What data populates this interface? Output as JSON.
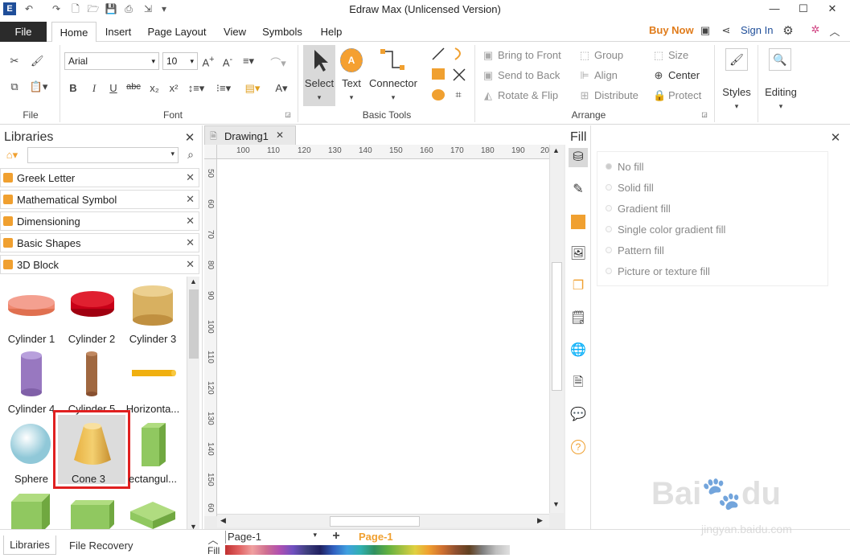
{
  "window": {
    "title": "Edraw Max (Unlicensed Version)"
  },
  "menu": {
    "file": "File",
    "tabs": [
      "Home",
      "Insert",
      "Page Layout",
      "View",
      "Symbols",
      "Help"
    ],
    "buy_now": "Buy Now",
    "sign_in": "Sign In"
  },
  "ribbon": {
    "font_family": "Arial",
    "font_size": "10",
    "groups": {
      "file": "File",
      "font": "Font",
      "basic_tools": "Basic Tools",
      "arrange": "Arrange"
    },
    "tools": {
      "select": "Select",
      "text": "Text",
      "connector": "Connector"
    },
    "arrange": {
      "bring_to_front": "Bring to Front",
      "send_to_back": "Send to Back",
      "rotate_flip": "Rotate & Flip",
      "group": "Group",
      "align": "Align",
      "distribute": "Distribute",
      "size": "Size",
      "center": "Center",
      "protect": "Protect"
    },
    "styles": "Styles",
    "editing": "Editing"
  },
  "libraries": {
    "title": "Libraries",
    "items": [
      "Greek Letter",
      "Mathematical Symbol",
      "Dimensioning",
      "Basic Shapes",
      "3D Block"
    ],
    "shapes": [
      "Cylinder 1",
      "Cylinder 2",
      "Cylinder 3",
      "Cylinder 4",
      "Cylinder 5",
      "Horizonta...",
      "Sphere",
      "Cone 3",
      "ectangul..."
    ],
    "bottom_tabs": [
      "Libraries",
      "File Recovery"
    ]
  },
  "document": {
    "tab": "Drawing1",
    "ruler_h": [
      "100",
      "110",
      "120",
      "130",
      "140",
      "150",
      "160",
      "170",
      "180",
      "190",
      "20"
    ],
    "ruler_v": [
      "50",
      "60",
      "70",
      "80",
      "90",
      "100",
      "110",
      "120",
      "130",
      "140",
      "150",
      "60"
    ],
    "page_select": "Page-1",
    "page_tab": "Page-1",
    "fill_label": "Fill"
  },
  "fill_panel": {
    "title": "Fill",
    "options": [
      "No fill",
      "Solid fill",
      "Gradient fill",
      "Single color gradient fill",
      "Pattern fill",
      "Picture or texture fill"
    ]
  },
  "colors": {
    "accent_orange": "#f0a030",
    "highlight_red": "#e02020",
    "buy_now": "#e07b1a"
  }
}
